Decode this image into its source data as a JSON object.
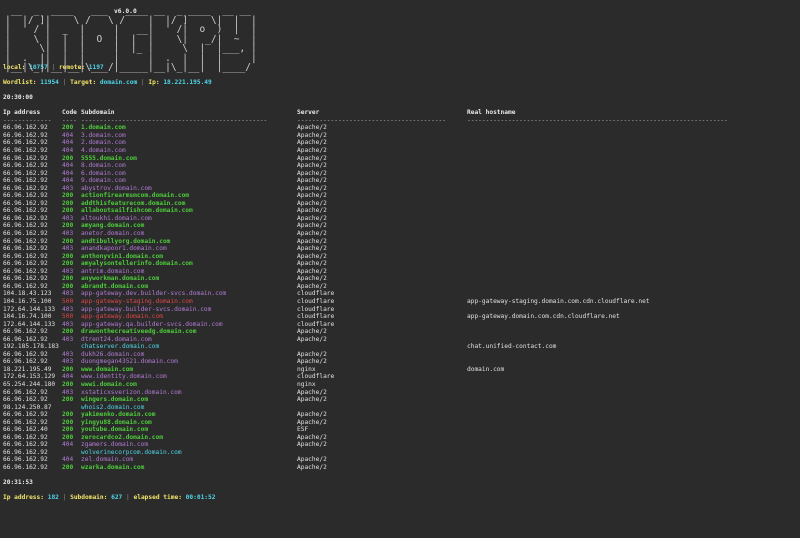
{
  "app": {
    "version": "v6.0.0",
    "logo_text": "knockpy"
  },
  "stats": {
    "local_label": "local:",
    "local_value": "10757",
    "remote_label": "remote:",
    "remote_value": "1197",
    "wordlist_label": "Wordlist:",
    "wordlist_value": "11954",
    "target_label": "Target:",
    "target_value": "domain.com",
    "ip_label": "Ip:",
    "ip_value": "18.221.195.49",
    "start_time": "20:30:00",
    "end_time": "20:31:53",
    "footer_ip_label": "Ip address:",
    "footer_ip_value": "182",
    "footer_sub_label": "Subdomain:",
    "footer_sub_value": "627",
    "footer_elapsed_label": "elapsed time:",
    "footer_elapsed_value": "00:01:52"
  },
  "table": {
    "headers": [
      "Ip address",
      "Code",
      "Subdomain",
      "Server",
      "Real hostname"
    ],
    "dashes": [
      "-------------",
      "----",
      "--------------------------------------------------",
      "----------------------------------------",
      "----------------------------------------------------------------------"
    ],
    "rows": [
      [
        "66.96.162.92",
        "200",
        "1.domain.com",
        "Apache/2",
        ""
      ],
      [
        "66.96.162.92",
        "404",
        "3.domain.com",
        "Apache/2",
        ""
      ],
      [
        "66.96.162.92",
        "404",
        "2.domain.com",
        "Apache/2",
        ""
      ],
      [
        "66.96.162.92",
        "404",
        "4.domain.com",
        "Apache/2",
        ""
      ],
      [
        "66.96.162.92",
        "200",
        "5555.domain.com",
        "Apache/2",
        ""
      ],
      [
        "66.96.162.92",
        "404",
        "8.domain.com",
        "Apache/2",
        ""
      ],
      [
        "66.96.162.92",
        "404",
        "6.domain.com",
        "Apache/2",
        ""
      ],
      [
        "66.96.162.92",
        "404",
        "9.domain.com",
        "Apache/2",
        ""
      ],
      [
        "66.96.162.92",
        "403",
        "abystrov.domain.com",
        "Apache/2",
        ""
      ],
      [
        "66.96.162.92",
        "200",
        "actionfirearmsmcom.domain.com",
        "Apache/2",
        ""
      ],
      [
        "66.96.162.92",
        "200",
        "addthisfeaturecom.domain.com",
        "Apache/2",
        ""
      ],
      [
        "66.96.162.92",
        "200",
        "allaboutsailfishcom.domain.com",
        "Apache/2",
        ""
      ],
      [
        "66.96.162.92",
        "403",
        "altoukhi.domain.com",
        "Apache/2",
        ""
      ],
      [
        "66.96.162.92",
        "200",
        "amyang.domain.com",
        "Apache/2",
        ""
      ],
      [
        "66.96.162.92",
        "403",
        "anetor.domain.com",
        "Apache/2",
        ""
      ],
      [
        "66.96.162.92",
        "200",
        "andtibullyorg.domain.com",
        "Apache/2",
        ""
      ],
      [
        "66.96.162.92",
        "403",
        "anandkapoor1.domain.com",
        "Apache/2",
        ""
      ],
      [
        "66.96.162.92",
        "200",
        "anthonyvin1.domain.com",
        "Apache/2",
        ""
      ],
      [
        "66.96.162.92",
        "200",
        "amyalysontellerinfo.domain.com",
        "Apache/2",
        ""
      ],
      [
        "66.96.162.92",
        "403",
        "antrim.domain.com",
        "Apache/2",
        ""
      ],
      [
        "66.96.162.92",
        "200",
        "anyworkman.domain.com",
        "Apache/2",
        ""
      ],
      [
        "66.96.162.92",
        "200",
        "abrandt.domain.com",
        "Apache/2",
        ""
      ],
      [
        "104.18.43.123",
        "403",
        "app-gateway.dev.builder-svcs.domain.com",
        "cloudflare",
        ""
      ],
      [
        "104.16.75.100",
        "500",
        "app-gateway-staging.domain.com",
        "cloudflare",
        "app-gateway-staging.domain.com.cdn.cloudflare.net"
      ],
      [
        "172.64.144.133",
        "403",
        "app-gateway.builder-svcs.domain.com",
        "cloudflare",
        ""
      ],
      [
        "104.16.74.100",
        "500",
        "app-gateway.domain.com",
        "cloudflare",
        "app-gateway.domain.com.cdn.cloudflare.net"
      ],
      [
        "172.64.144.133",
        "403",
        "app-gateway.qa.builder-svcs.domain.com",
        "cloudflare",
        ""
      ],
      [
        "66.96.162.92",
        "200",
        "drawonthecreativeedg.domain.com",
        "Apache/2",
        ""
      ],
      [
        "66.96.162.92",
        "403",
        "dtrent24.domain.com",
        "Apache/2",
        ""
      ],
      [
        "192.185.178.183",
        "",
        "chatserver.domain.com",
        "",
        "chat.unified-contact.com"
      ],
      [
        "66.96.162.92",
        "403",
        "dukh26.domain.com",
        "Apache/2",
        ""
      ],
      [
        "66.96.162.92",
        "403",
        "duongmegan43521.domain.com",
        "Apache/2",
        ""
      ],
      [
        "18.221.195.49",
        "200",
        "www.domain.com",
        "nginx",
        "domain.com"
      ],
      [
        "172.64.153.129",
        "404",
        "www.identity.domain.com",
        "cloudflare",
        ""
      ],
      [
        "65.254.244.180",
        "200",
        "wwwi.domain.com",
        "nginx",
        ""
      ],
      [
        "66.96.162.92",
        "403",
        "xstaticxsverizon.domain.com",
        "Apache/2",
        ""
      ],
      [
        "66.96.162.92",
        "200",
        "wingers.domain.com",
        "Apache/2",
        ""
      ],
      [
        "98.124.250.87",
        "",
        "whois2.domain.com",
        "",
        ""
      ],
      [
        "66.96.162.92",
        "200",
        "yakimenko.domain.com",
        "Apache/2",
        ""
      ],
      [
        "66.96.162.92",
        "200",
        "yingyu88.domain.com",
        "Apache/2",
        ""
      ],
      [
        "66.96.162.40",
        "200",
        "youtube.domain.com",
        "ESF",
        ""
      ],
      [
        "66.96.162.92",
        "200",
        "zerocardco2.domain.com",
        "Apache/2",
        ""
      ],
      [
        "66.96.162.92",
        "404",
        "zgamers.domain.com",
        "Apache/2",
        ""
      ],
      [
        "66.96.162.92",
        "",
        "wolverinecorpcom.domain.com",
        "",
        ""
      ],
      [
        "66.96.162.92",
        "404",
        "zel.domain.com",
        "Apache/2",
        ""
      ],
      [
        "66.96.162.92",
        "200",
        "wzarka.domain.com",
        "Apache/2",
        ""
      ]
    ]
  },
  "colors": {
    "ok_200": "#4ecb3c",
    "notfound_404": "#b37bd6",
    "forbidden_403": "#b37bd6",
    "error_500": "#e04848",
    "nocode": "#4fd5e8",
    "label_yellow": "#f3e56a",
    "value_cyan": "#4fd5e8",
    "background": "#2b2b2b"
  }
}
